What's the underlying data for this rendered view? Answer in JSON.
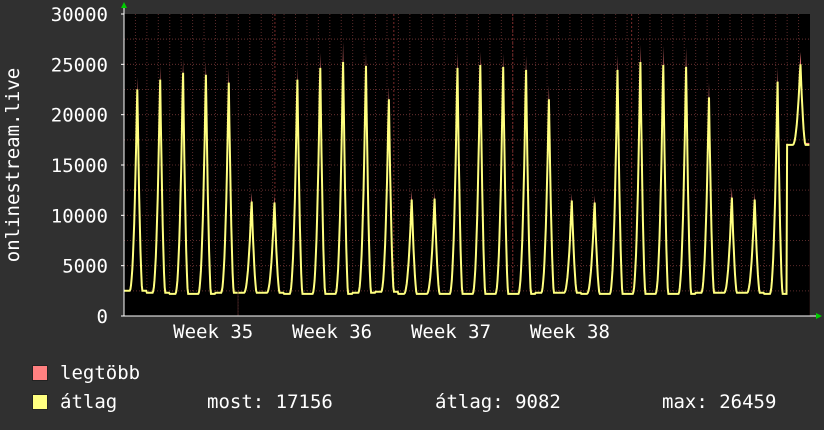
{
  "chart_data": {
    "type": "area",
    "ylabel": "onlinestream.live",
    "ylim": [
      0,
      30000
    ],
    "yticks": [
      0,
      5000,
      10000,
      15000,
      20000,
      25000,
      30000
    ],
    "xticks": [
      "Week 35",
      "Week 36",
      "Week 37",
      "Week 38"
    ],
    "grid": true,
    "series": [
      {
        "name": "legtöbb",
        "color": "#ff8080"
      },
      {
        "name": "átlag",
        "color": "#ffff80"
      }
    ],
    "days": [
      {
        "gap": false,
        "peak_max": 24000,
        "peak_avg": 23000,
        "trough": 2500
      },
      {
        "gap": false,
        "peak_max": 25200,
        "peak_avg": 24000,
        "trough": 2300
      },
      {
        "gap": false,
        "peak_max": 25800,
        "peak_avg": 24700,
        "trough": 2200
      },
      {
        "gap": false,
        "peak_max": 25600,
        "peak_avg": 24500,
        "trough": 2200
      },
      {
        "gap": false,
        "peak_max": 24900,
        "peak_avg": 23700,
        "trough": 2300
      },
      {
        "gap": true,
        "peak_max": 12300,
        "peak_avg": 11600,
        "trough": 2300
      },
      {
        "gap": false,
        "peak_max": 12000,
        "peak_avg": 11500,
        "trough": 2300
      },
      {
        "gap": false,
        "peak_max": 25000,
        "peak_avg": 24000,
        "trough": 2200
      },
      {
        "gap": false,
        "peak_max": 26500,
        "peak_avg": 25200,
        "trough": 2200
      },
      {
        "gap": false,
        "peak_max": 27600,
        "peak_avg": 25800,
        "trough": 2200
      },
      {
        "gap": false,
        "peak_max": 26500,
        "peak_avg": 25400,
        "trough": 2300
      },
      {
        "gap": false,
        "peak_max": 23000,
        "peak_avg": 22000,
        "trough": 2400
      },
      {
        "gap": false,
        "peak_max": 12500,
        "peak_avg": 11800,
        "trough": 2200
      },
      {
        "gap": false,
        "peak_max": 12400,
        "peak_avg": 11900,
        "trough": 2200
      },
      {
        "gap": false,
        "peak_max": 26500,
        "peak_avg": 25200,
        "trough": 2200
      },
      {
        "gap": false,
        "peak_max": 26600,
        "peak_avg": 25500,
        "trough": 2200
      },
      {
        "gap": false,
        "peak_max": 26400,
        "peak_avg": 25300,
        "trough": 2200
      },
      {
        "gap": false,
        "peak_max": 26200,
        "peak_avg": 25000,
        "trough": 2200
      },
      {
        "gap": false,
        "peak_max": 23200,
        "peak_avg": 22000,
        "trough": 2300
      },
      {
        "gap": false,
        "peak_max": 12200,
        "peak_avg": 11700,
        "trough": 2300
      },
      {
        "gap": false,
        "peak_max": 12000,
        "peak_avg": 11500,
        "trough": 2200
      },
      {
        "gap": false,
        "peak_max": 26300,
        "peak_avg": 25000,
        "trough": 2200
      },
      {
        "gap": false,
        "peak_max": 27300,
        "peak_avg": 25800,
        "trough": 2200
      },
      {
        "gap": false,
        "peak_max": 27200,
        "peak_avg": 25500,
        "trough": 2200
      },
      {
        "gap": false,
        "peak_max": 27000,
        "peak_avg": 25300,
        "trough": 2200
      },
      {
        "gap": false,
        "peak_max": 23500,
        "peak_avg": 22200,
        "trough": 2300
      },
      {
        "gap": false,
        "peak_max": 12800,
        "peak_avg": 12000,
        "trough": 2300
      },
      {
        "gap": false,
        "peak_max": 12300,
        "peak_avg": 11800,
        "trough": 2300
      },
      {
        "gap": false,
        "peak_max": 25000,
        "peak_avg": 23800,
        "trough": 2200
      },
      {
        "gap": false,
        "peak_max": 26200,
        "peak_avg": 25200,
        "trough": 17000
      }
    ]
  },
  "legend": {
    "max_label": "legtöbb",
    "avg_label": "átlag",
    "now_text": "most: 17156",
    "avg_text": "átlag: 9082",
    "max_text": "max: 26459"
  },
  "colors": {
    "background": "#303030",
    "plot_bg": "#000000",
    "grid": "#5a2a2a",
    "axis_text": "#ffffff",
    "max_fill": "#ff8080",
    "avg_line": "#ffff80"
  }
}
